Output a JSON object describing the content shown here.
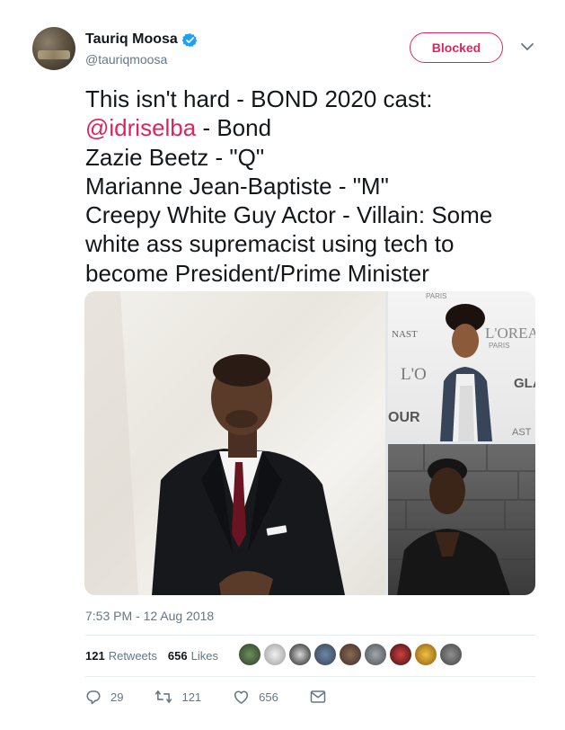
{
  "author": {
    "display_name": "Tauriq Moosa",
    "handle": "@tauriqmoosa",
    "verified": true
  },
  "header": {
    "blocked_label": "Blocked"
  },
  "tweet": {
    "lines": [
      "This isn't hard - BOND 2020 cast:",
      "@idriselba",
      " - Bond\nZazie Beetz - \"Q\"\nMarianne Jean-Baptiste - \"M\"\nCreepy White Guy Actor - Villain: Some white ass supremacist using tech to become President/Prime Minister"
    ],
    "timestamp": "7:53 PM - 12 Aug 2018"
  },
  "media": {
    "photo_top_right_signage": [
      "PARIS",
      "NAST",
      "L'OREAL",
      "PARIS",
      "L'O",
      "GLA",
      "OUR",
      "AST"
    ]
  },
  "stats": {
    "retweets_count": "121",
    "retweets_label": "Retweets",
    "likes_count": "656",
    "likes_label": "Likes"
  },
  "actions": {
    "replies": "29",
    "retweets": "121",
    "likes": "656"
  },
  "colors": {
    "accent": "#e0245e",
    "verified": "#1da1f2",
    "muted": "#657786"
  }
}
